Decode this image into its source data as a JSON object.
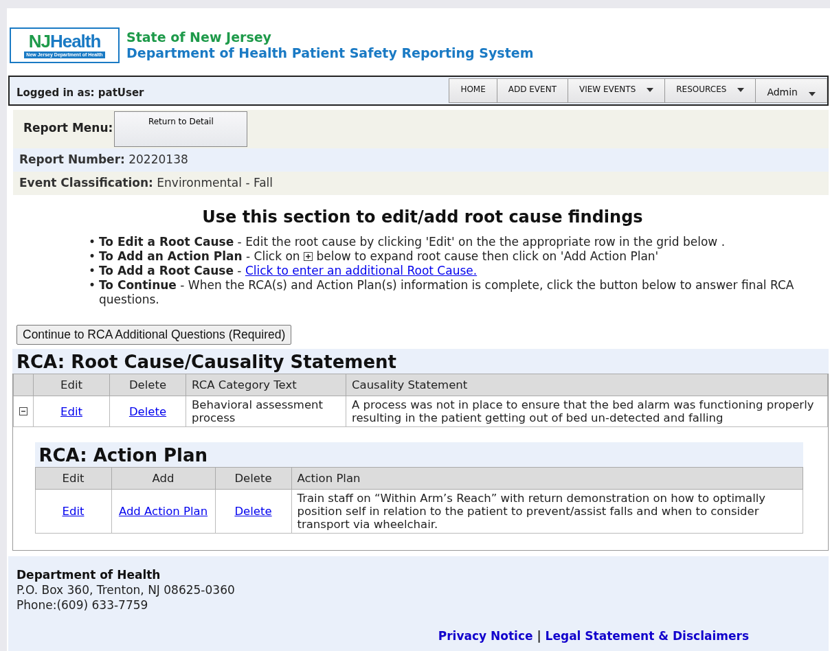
{
  "header": {
    "logo": {
      "mark": "NJ",
      "word": "Health",
      "subtitle": "New Jersey Department of Health"
    },
    "state": "State of New Jersey",
    "system": "Department of Health Patient Safety Reporting System"
  },
  "nav": {
    "logged_in": "Logged in as: patUser",
    "menu": [
      {
        "label": "HOME",
        "dropdown": false,
        "kind": "small"
      },
      {
        "label": "ADD EVENT",
        "dropdown": false,
        "kind": "small"
      },
      {
        "label": "VIEW EVENTS",
        "dropdown": true,
        "kind": "small"
      },
      {
        "label": "RESOURCES",
        "dropdown": true,
        "kind": "small"
      },
      {
        "label": "Admin",
        "dropdown": true,
        "kind": "large"
      }
    ]
  },
  "report_menu": {
    "label": "Report Menu:",
    "button": "Return to Detail"
  },
  "report_info": [
    {
      "label": "Report Number:",
      "value": "20220138"
    },
    {
      "label": "Event Classification:",
      "value": "Environmental - Fall"
    }
  ],
  "heading": "Use this section to edit/add root cause findings",
  "instructions": [
    {
      "marker": "•",
      "title": "To Edit a Root Cause",
      "parts": [
        {
          "kind": "text",
          "text": " - Edit the root cause by clicking 'Edit' on the the appropriate row in the grid below ."
        }
      ]
    },
    {
      "marker": "•",
      "title": "To Add an Action Plan",
      "parts": [
        {
          "kind": "text",
          "text": " - Click on "
        },
        {
          "kind": "icon"
        },
        {
          "kind": "text",
          "text": " below to expand root cause then click on 'Add Action Plan'"
        }
      ]
    },
    {
      "marker": "•",
      "title": "To Add a Root Cause",
      "parts": [
        {
          "kind": "text",
          "text": " -  "
        },
        {
          "kind": "link",
          "text": "Click to enter an additional Root Cause."
        }
      ]
    },
    {
      "marker": "•",
      "title": "To Continue",
      "parts": [
        {
          "kind": "text",
          "text": " - When the RCA(s) and Action Plan(s) information is complete, click the button below to answer final RCA questions."
        }
      ]
    }
  ],
  "continue_button": "Continue to RCA Additional Questions (Required)",
  "root_cause": {
    "title": "RCA: Root Cause/Causality Statement",
    "columns": [
      "Edit",
      "Delete",
      "RCA Category Text",
      "Causality Statement"
    ],
    "rows": [
      {
        "expanded": true,
        "edit": "Edit",
        "delete": "Delete",
        "category": "Behavioral assessment process",
        "statement": "A process was not in place to ensure that the bed alarm was functioning properly resulting in the patient getting out of bed un-detected and falling",
        "action_plan": {
          "title": "RCA: Action Plan",
          "columns": [
            "Edit",
            "Add",
            "Delete",
            "Action Plan"
          ],
          "rows": [
            {
              "edit": "Edit",
              "add": "Add Action Plan",
              "delete": "Delete",
              "plan": "Train staff on “Within Arm’s Reach” with return demonstration on how to optimally position self in relation to the patient to prevent/assist falls and when to consider transport via wheelchair."
            }
          ]
        }
      }
    ]
  },
  "footer": {
    "org": "Department of Health",
    "address": "P.O. Box 360, Trenton, NJ 08625-0360",
    "phone": "Phone:(609) 633-7759",
    "separator": "|",
    "links": [
      "Privacy Notice",
      "Legal Statement & Disclaimers"
    ]
  }
}
